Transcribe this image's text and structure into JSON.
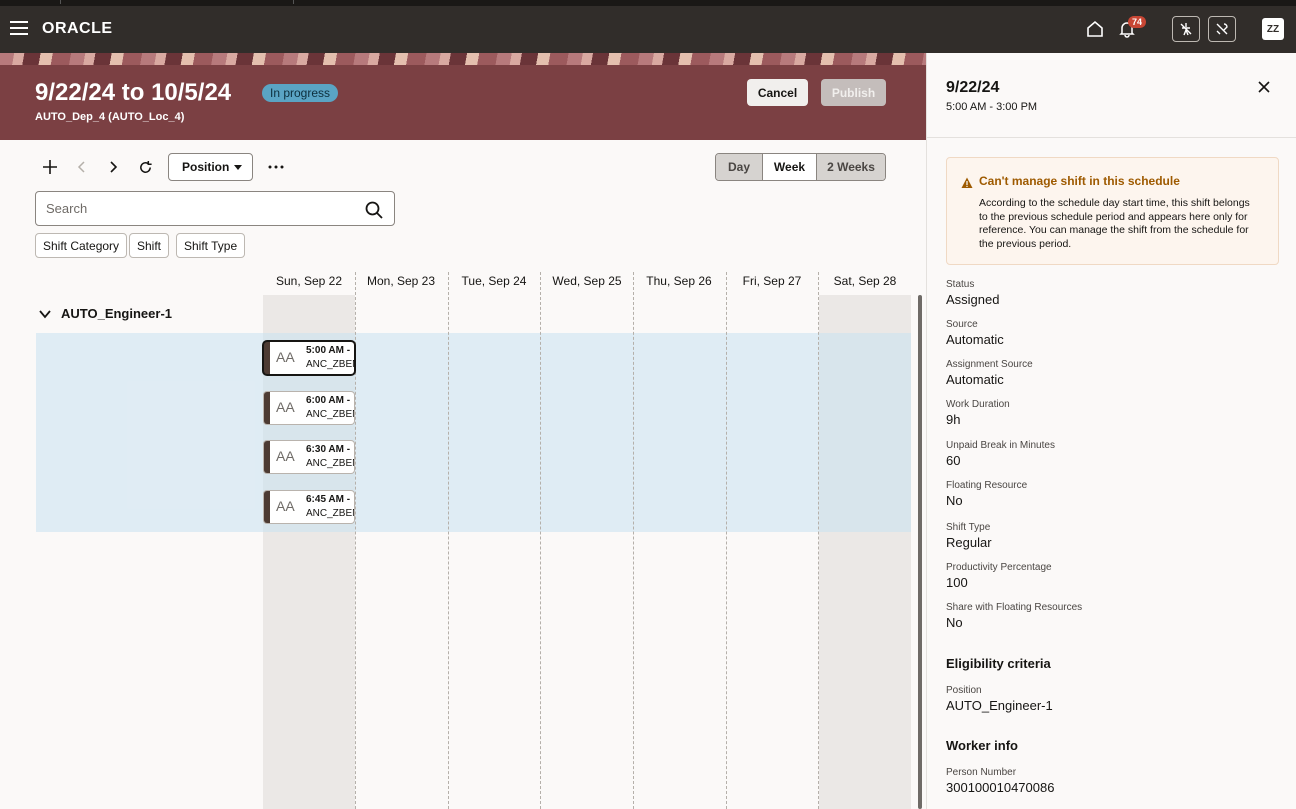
{
  "app": {
    "brand": "ORACLE",
    "notification_count": "74",
    "user_initials": "ZZ"
  },
  "header": {
    "title": "9/22/24 to 10/5/24",
    "status": "In progress",
    "subtitle": "AUTO_Dep_4 (AUTO_Loc_4)",
    "cancel_label": "Cancel",
    "publish_label": "Publish"
  },
  "toolbar": {
    "position_label": "Position",
    "views": {
      "day": "Day",
      "week": "Week",
      "two_weeks": "2 Weeks"
    }
  },
  "search": {
    "placeholder": "Search",
    "value": ""
  },
  "filters": [
    "Shift Category",
    "Shift",
    "Shift Type"
  ],
  "calendar": {
    "days": [
      "Sun, Sep 22",
      "Mon, Sep 23",
      "Tue, Sep 24",
      "Wed, Sep 25",
      "Thu, Sep 26",
      "Fri, Sep 27",
      "Sat, Sep 28"
    ],
    "group": "AUTO_Engineer-1",
    "shifts": [
      {
        "initials": "AA",
        "time": "5:00 AM - ",
        "code": "ANC_ZBEN"
      },
      {
        "initials": "AA",
        "time": "6:00 AM - ",
        "code": "ANC_ZBEN"
      },
      {
        "initials": "AA",
        "time": "6:30 AM - ",
        "code": "ANC_ZBEN"
      },
      {
        "initials": "AA",
        "time": "6:45 AM - ",
        "code": "ANC_ZBEN"
      }
    ]
  },
  "panel": {
    "date": "9/22/24",
    "time": "5:00 AM - 3:00 PM",
    "warning": {
      "title": "Can't manage shift in this schedule",
      "body": "According to the schedule day start time, this shift belongs to the previous schedule period and appears here only for reference. You can manage the shift from the schedule for the previous period."
    },
    "fields": [
      {
        "label": "Status",
        "value": "Assigned"
      },
      {
        "label": "Source",
        "value": "Automatic"
      },
      {
        "label": "Assignment Source",
        "value": "Automatic"
      },
      {
        "label": "Work Duration",
        "value": "9h"
      },
      {
        "label": "Unpaid Break in Minutes",
        "value": "60"
      },
      {
        "label": "Floating Resource",
        "value": "No"
      },
      {
        "label": "Shift Type",
        "value": "Regular"
      },
      {
        "label": "Productivity Percentage",
        "value": "100"
      },
      {
        "label": "Share with Floating Resources",
        "value": "No"
      }
    ],
    "eligibility": {
      "title": "Eligibility criteria",
      "label": "Position",
      "value": "AUTO_Engineer-1"
    },
    "worker": {
      "title": "Worker info",
      "label": "Person Number",
      "value": "300100010470086"
    }
  }
}
